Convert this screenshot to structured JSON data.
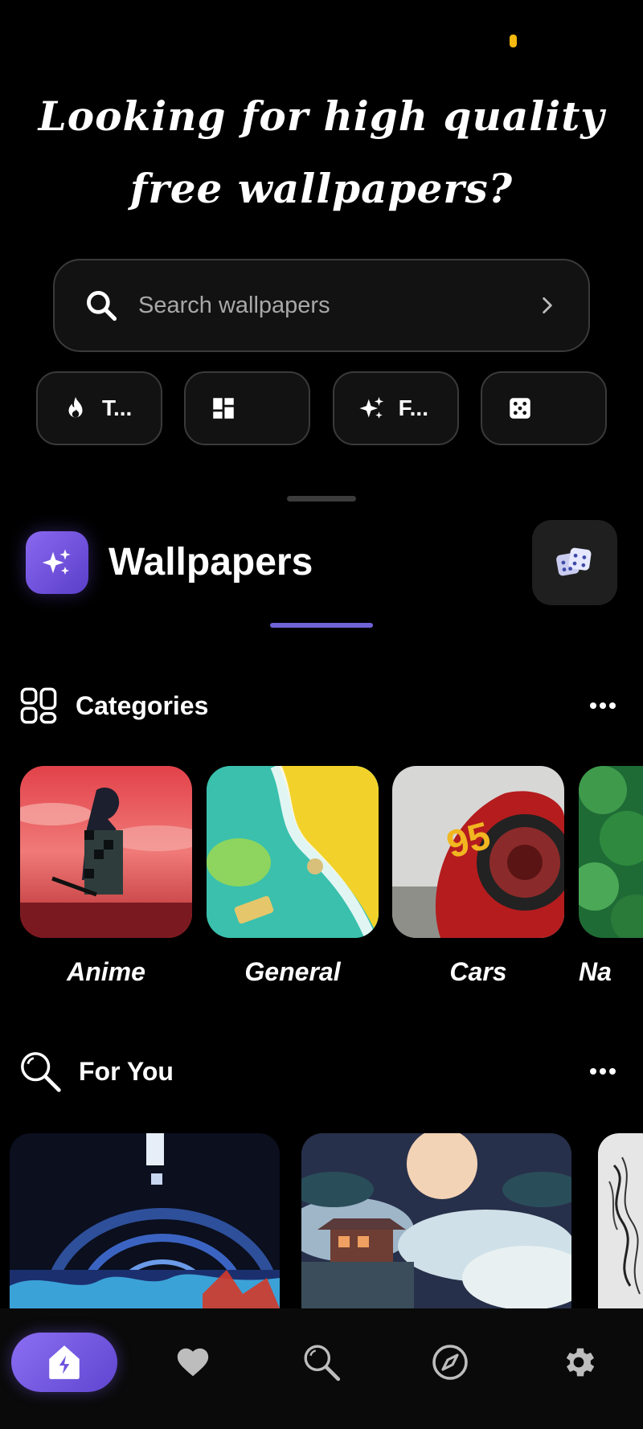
{
  "hero": {
    "line1": "Looking for high quality",
    "line2": "free wallpapers?"
  },
  "search": {
    "placeholder": "Search wallpapers",
    "icon": "search-icon",
    "trailing_icon": "chevron-right-icon"
  },
  "quick_actions": [
    {
      "icon": "flame-icon",
      "label": "T..."
    },
    {
      "icon": "grid-icon",
      "label": ""
    },
    {
      "icon": "sparkle-icon",
      "label": "F..."
    },
    {
      "icon": "dice-icon",
      "label": ""
    }
  ],
  "header": {
    "title": "Wallpapers",
    "logo_icon": "sparkle-icon",
    "action_icon": "dice-icon"
  },
  "categories": {
    "title": "Categories",
    "icon": "grid-outline-icon",
    "items": [
      {
        "label": "Anime"
      },
      {
        "label": "General"
      },
      {
        "label": "Cars"
      },
      {
        "label": "Na"
      }
    ]
  },
  "for_you": {
    "title": "For You",
    "icon": "search-icon"
  },
  "bottom_nav": [
    {
      "icon": "home-icon",
      "active": true
    },
    {
      "icon": "heart-icon"
    },
    {
      "icon": "search-icon"
    },
    {
      "icon": "compass-icon"
    },
    {
      "icon": "gear-icon"
    }
  ],
  "colors": {
    "accent": "#6f63d8",
    "status_dot": "#f5b90f"
  }
}
